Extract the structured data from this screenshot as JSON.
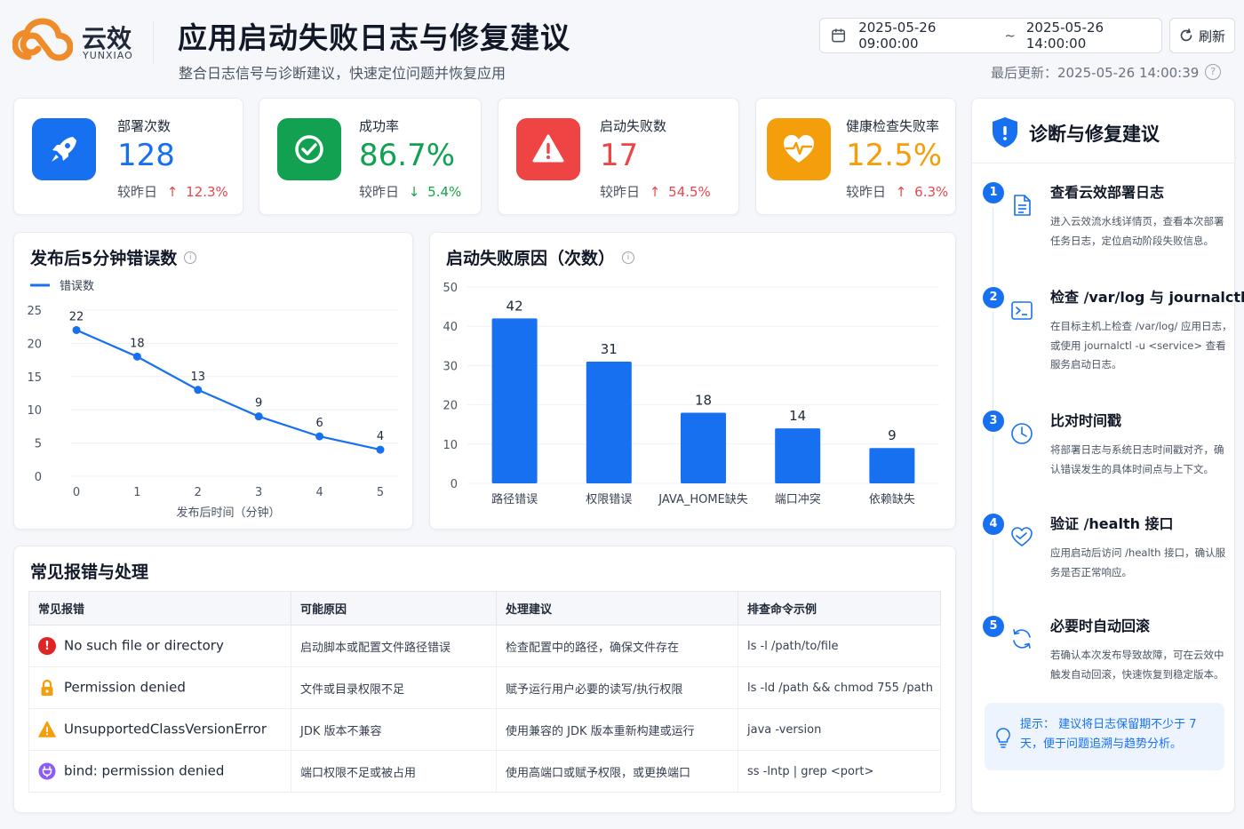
{
  "colors": {
    "primary": "#1670f0",
    "success": "#12a150",
    "danger": "#ef4444",
    "warning": "#f59e0b",
    "up": "#e5484d",
    "down": "#16a34a"
  },
  "header": {
    "logo_cn": "云效",
    "logo_en": "YUNXIAO",
    "title": "应用启动失败日志与修复建议",
    "subtitle": "整合日志信号与诊断建议，快速定位问题并恢复应用",
    "date_start": "2025-05-26 09:00:00",
    "date_sep": "~",
    "date_end": "2025-05-26 14:00:00",
    "refresh_label": "刷新",
    "last_update": "最后更新：2025-05-26 14:00:39",
    "help_icon": "?"
  },
  "stats": [
    {
      "label": "部署次数",
      "value": "128",
      "compare_label": "较昨日",
      "trend": "up",
      "arrow": "↑",
      "change": "12.3%",
      "icon": "rocket-icon",
      "color": "#1670f0"
    },
    {
      "label": "成功率",
      "value": "86.7%",
      "compare_label": "较昨日",
      "trend": "down",
      "arrow": "↓",
      "change": "5.4%",
      "icon": "check-icon",
      "color": "#12a150"
    },
    {
      "label": "启动失败数",
      "value": "17",
      "compare_label": "较昨日",
      "trend": "up",
      "arrow": "↑",
      "change": "54.5%",
      "icon": "warning-icon",
      "color": "#ef4444"
    },
    {
      "label": "健康检查失败率",
      "value": "12.5%",
      "compare_label": "较昨日",
      "trend": "up",
      "arrow": "↑",
      "change": "6.3%",
      "icon": "heart-pulse-icon",
      "color": "#f59e0b"
    }
  ],
  "line_card": {
    "title": "发布后5分钟错误数",
    "info_icon": "i"
  },
  "bar_card": {
    "title": "启动失败原因（次数）",
    "info_icon": "i"
  },
  "chart_data": [
    {
      "type": "line",
      "title": "发布后5分钟错误数",
      "xlabel": "发布后时间（分钟）",
      "ylabel": "",
      "x": [
        0,
        1,
        2,
        3,
        4,
        5
      ],
      "series": [
        {
          "name": "错误数",
          "values": [
            22,
            18,
            13,
            9,
            6,
            4
          ]
        }
      ],
      "yticks": [
        0,
        5,
        10,
        15,
        20,
        25
      ],
      "ylim": [
        0,
        25
      ],
      "legend": "top-left",
      "grid": true,
      "color": "#1670f0"
    },
    {
      "type": "bar",
      "title": "启动失败原因（次数）",
      "categories": [
        "路径错误",
        "权限错误",
        "JAVA_HOME缺失",
        "端口冲突",
        "依赖缺失"
      ],
      "values": [
        42,
        31,
        18,
        14,
        9
      ],
      "yticks": [
        0,
        10,
        20,
        30,
        40,
        50
      ],
      "ylim": [
        0,
        50
      ],
      "grid": true,
      "color": "#1670f0"
    }
  ],
  "table": {
    "title": "常见报错与处理",
    "headers": [
      "常见报错",
      "可能原因",
      "处理建议",
      "排查命令示例"
    ],
    "rows": [
      {
        "icon": "error-icon",
        "icon_color": "#e02424",
        "icon_glyph": "!",
        "error": "No such file or directory",
        "cause": "启动脚本或配置文件路径错误",
        "fix": "检查配置中的路径，确保文件存在",
        "cmd": "ls -l /path/to/file"
      },
      {
        "icon": "lock-icon",
        "icon_color": "#f59e0b",
        "icon_glyph": "",
        "error": "Permission denied",
        "cause": "文件或目录权限不足",
        "fix": "赋予运行用户必要的读写/执行权限",
        "cmd": "ls -ld /path && chmod 755 /path"
      },
      {
        "icon": "warning-icon",
        "icon_color": "#f59e0b",
        "icon_glyph": "!",
        "error": "UnsupportedClassVersionError",
        "cause": "JDK 版本不兼容",
        "fix": "使用兼容的 JDK 版本重新构建或运行",
        "cmd": "java -version"
      },
      {
        "icon": "plug-icon",
        "icon_color": "#8b5cf6",
        "icon_glyph": "",
        "error": "bind: permission denied",
        "cause": "端口权限不足或被占用",
        "fix": "使用高端口或赋予权限，或更换端口",
        "cmd": "ss -lntp | grep <port>"
      }
    ]
  },
  "diagnosis": {
    "title": "诊断与修复建议",
    "steps": [
      {
        "num": "1",
        "icon": "document-icon",
        "title": "查看云效部署日志",
        "desc": "进入云效流水线详情页，查看本次部署任务日志，定位启动阶段失败信息。"
      },
      {
        "num": "2",
        "icon": "terminal-icon",
        "title": "检查 /var/log 与 journalctl",
        "desc": "在目标主机上检查 /var/log/ 应用日志，或使用 journalctl -u <service> 查看服务启动日志。"
      },
      {
        "num": "3",
        "icon": "clock-icon",
        "title": "比对时间戳",
        "desc": "将部署日志与系统日志时间戳对齐，确认错误发生的具体时间点与上下文。"
      },
      {
        "num": "4",
        "icon": "heart-icon",
        "title": "验证 /health 接口",
        "desc": "应用启动后访问 /health 接口，确认服务是否正常响应。"
      },
      {
        "num": "5",
        "icon": "rollback-icon",
        "title": "必要时自动回滚",
        "desc": "若确认本次发布导致故障，可在云效中触发自动回滚，快速恢复到稳定版本。"
      }
    ],
    "tip": "提示：  建议将日志保留期不少于 7 天，便于问题追溯与趋势分析。"
  }
}
